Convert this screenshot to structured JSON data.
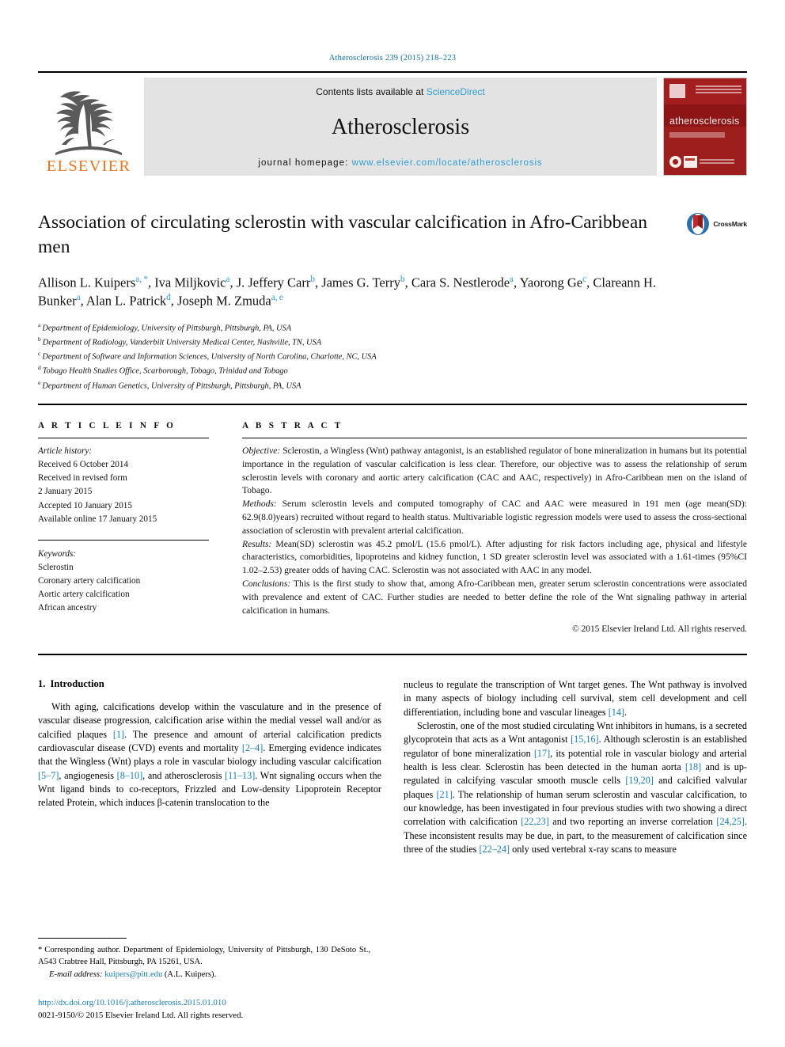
{
  "running_head": "Atherosclerosis 239 (2015) 218–223",
  "journal_header": {
    "publisher_name": "ELSEVIER",
    "contents_prefix": "Contents lists available at",
    "contents_link": "ScienceDirect",
    "journal_title": "Atherosclerosis",
    "homepage_prefix": "journal homepage:",
    "homepage_url": "www.elsevier.com/locate/atherosclerosis",
    "cover_title": "atherosclerosis",
    "accent_link_color": "#2e9fd4",
    "band_color": "#e3e3e3",
    "cover_color": "#9b1b1b",
    "elsevier_orange": "#E87722"
  },
  "article": {
    "title": "Association of circulating sclerostin with vascular calcification in Afro-Caribbean men",
    "crossmark_label": "CrossMark",
    "authors_line_1": "Allison L. Kuipers a, *, Iva Miljkovic a, J. Jeffery Carr b, James G. Terry b, Cara S. Nestlerode a,",
    "authors_line_2": "Yaorong Ge c, Clareann H. Bunker a, Alan L. Patrick d, Joseph M. Zmuda a, e",
    "authors": [
      {
        "name": "Allison L. Kuipers",
        "marks": "a, *"
      },
      {
        "name": "Iva Miljkovic",
        "marks": "a"
      },
      {
        "name": "J. Jeffery Carr",
        "marks": "b"
      },
      {
        "name": "James G. Terry",
        "marks": "b"
      },
      {
        "name": "Cara S. Nestlerode",
        "marks": "a"
      },
      {
        "name": "Yaorong Ge",
        "marks": "c"
      },
      {
        "name": "Clareann H. Bunker",
        "marks": "a"
      },
      {
        "name": "Alan L. Patrick",
        "marks": "d"
      },
      {
        "name": "Joseph M. Zmuda",
        "marks": "a, e"
      }
    ],
    "affiliations": [
      {
        "mark": "a",
        "text": "Department of Epidemiology, University of Pittsburgh, Pittsburgh, PA, USA"
      },
      {
        "mark": "b",
        "text": "Department of Radiology, Vanderbilt University Medical Center, Nashville, TN, USA"
      },
      {
        "mark": "c",
        "text": "Department of Software and Information Sciences, University of North Carolina, Charlotte, NC, USA"
      },
      {
        "mark": "d",
        "text": "Tobago Health Studies Office, Scarborough, Tobago, Trinidad and Tobago"
      },
      {
        "mark": "e",
        "text": "Department of Human Genetics, University of Pittsburgh, Pittsburgh, PA, USA"
      }
    ]
  },
  "article_info": {
    "heading": "A R T I C L E   I N F O",
    "history_label": "Article history:",
    "history": [
      "Received 6 October 2014",
      "Received in revised form",
      "2 January 2015",
      "Accepted 10 January 2015",
      "Available online 17 January 2015"
    ],
    "keywords_label": "Keywords:",
    "keywords": [
      "Sclerostin",
      "Coronary artery calcification",
      "Aortic artery calcification",
      "African ancestry"
    ]
  },
  "abstract": {
    "heading": "A B S T R A C T",
    "sections": [
      {
        "label": "Objective:",
        "text": " Sclerostin, a Wingless (Wnt) pathway antagonist, is an established regulator of bone mineralization in humans but its potential importance in the regulation of vascular calcification is less clear. Therefore, our objective was to assess the relationship of serum sclerostin levels with coronary and aortic artery calcification (CAC and AAC, respectively) in Afro-Caribbean men on the island of Tobago."
      },
      {
        "label": "Methods:",
        "text": " Serum sclerostin levels and computed tomography of CAC and AAC were measured in 191 men (age mean(SD): 62.9(8.0)years) recruited without regard to health status. Multivariable logistic regression models were used to assess the cross-sectional association of sclerostin with prevalent arterial calcification."
      },
      {
        "label": "Results:",
        "text": " Mean(SD) sclerostin was 45.2 pmol/L (15.6 pmol/L). After adjusting for risk factors including age, physical and lifestyle characteristics, comorbidities, lipoproteins and kidney function, 1 SD greater sclerostin level was associated with a 1.61-times (95%CI 1.02–2.53) greater odds of having CAC. Sclerostin was not associated with AAC in any model."
      },
      {
        "label": "Conclusions:",
        "text": " This is the first study to show that, among Afro-Caribbean men, greater serum sclerostin concentrations were associated with prevalence and extent of CAC. Further studies are needed to better define the role of the Wnt signaling pathway in arterial calcification in humans."
      }
    ],
    "copyright": "© 2015 Elsevier Ireland Ltd. All rights reserved."
  },
  "introduction": {
    "number": "1.",
    "title": "Introduction",
    "left_paragraphs": [
      {
        "parts": [
          {
            "t": "With aging, calcifications develop within the vasculature and in the presence of vascular disease progression, calcification arise within the medial vessel wall and/or as calcified plaques "
          },
          {
            "t": "[1]",
            "ref": true
          },
          {
            "t": ". The presence and amount of arterial calcification predicts cardiovascular disease (CVD) events and mortality "
          },
          {
            "t": "[2–4]",
            "ref": true
          },
          {
            "t": ". Emerging evidence indicates that the Wingless (Wnt) plays a role in vascular biology including vascular calcification "
          },
          {
            "t": "[5–7]",
            "ref": true
          },
          {
            "t": ", angiogenesis "
          },
          {
            "t": "[8–10]",
            "ref": true
          },
          {
            "t": ", and atherosclerosis "
          },
          {
            "t": "[11–13]",
            "ref": true
          },
          {
            "t": ". Wnt signaling occurs when the Wnt ligand binds to co-receptors, Frizzled and Low-density Lipoprotein Receptor related Protein, which induces β-catenin translocation to the"
          }
        ]
      }
    ],
    "right_paragraphs": [
      {
        "indent": false,
        "parts": [
          {
            "t": "nucleus to regulate the transcription of Wnt target genes. The Wnt pathway is involved in many aspects of biology including cell survival, stem cell development and cell differentiation, including bone and vascular lineages "
          },
          {
            "t": "[14]",
            "ref": true
          },
          {
            "t": "."
          }
        ]
      },
      {
        "indent": true,
        "parts": [
          {
            "t": "Sclerostin, one of the most studied circulating Wnt inhibitors in humans, is a secreted glycoprotein that acts as a Wnt antagonist "
          },
          {
            "t": "[15,16]",
            "ref": true
          },
          {
            "t": ". Although sclerostin is an established regulator of bone mineralization "
          },
          {
            "t": "[17]",
            "ref": true
          },
          {
            "t": ", its potential role in vascular biology and arterial health is less clear. Sclerostin has been detected in the human aorta "
          },
          {
            "t": "[18]",
            "ref": true
          },
          {
            "t": " and is up-regulated in calcifying vascular smooth muscle cells "
          },
          {
            "t": "[19,20]",
            "ref": true
          },
          {
            "t": " and calcified valvular plaques "
          },
          {
            "t": "[21]",
            "ref": true
          },
          {
            "t": ". The relationship of human serum sclerostin and vascular calcification, to our knowledge, has been investigated in four previous studies with two showing a direct correlation with calcification "
          },
          {
            "t": "[22,23]",
            "ref": true
          },
          {
            "t": " and two reporting an inverse correlation "
          },
          {
            "t": "[24,25]",
            "ref": true
          },
          {
            "t": ". These inconsistent results may be due, in part, to the measurement of calcification since three of the studies "
          },
          {
            "t": "[22–24]",
            "ref": true
          },
          {
            "t": " only used vertebral x-ray scans to measure"
          }
        ]
      }
    ]
  },
  "footnote": {
    "star": "*",
    "corresponding": "Corresponding author. Department of Epidemiology, University of Pittsburgh, 130 DeSoto St., A543 Crabtree Hall, Pittsburgh, PA 15261, USA.",
    "email_label": "E-mail address:",
    "email": "kuipers@pitt.edu",
    "email_suffix": "(A.L. Kuipers).",
    "doi": "http://dx.doi.org/10.1016/j.atherosclerosis.2015.01.010",
    "issn_line": "0021-9150/© 2015 Elsevier Ireland Ltd. All rights reserved."
  }
}
